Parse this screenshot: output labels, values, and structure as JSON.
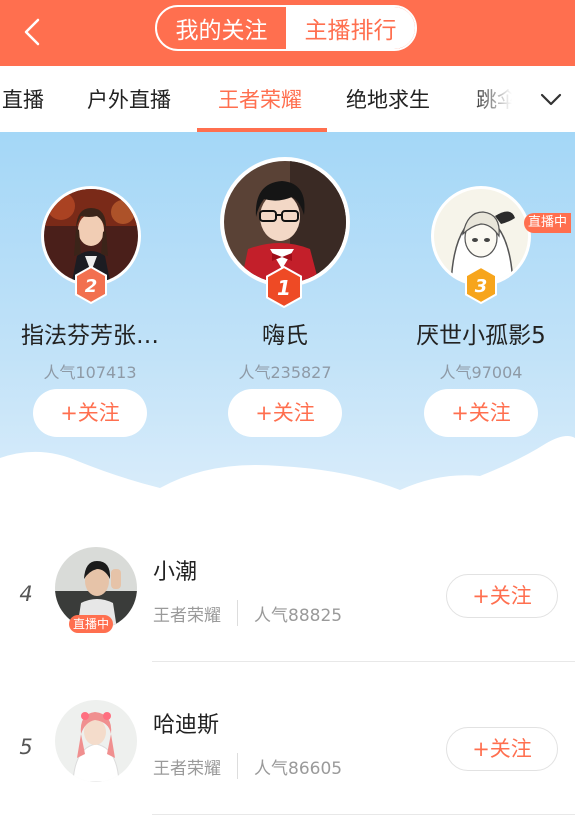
{
  "header": {
    "back_icon": "chevron-left-icon",
    "segments": [
      {
        "label": "我的关注",
        "active": false
      },
      {
        "label": "主播排行",
        "active": true
      }
    ]
  },
  "tabs": {
    "items": [
      {
        "label": "直播",
        "active": false
      },
      {
        "label": "户外直播",
        "active": false
      },
      {
        "label": "王者荣耀",
        "active": true
      },
      {
        "label": "绝地求生",
        "active": false
      },
      {
        "label": "跳伞",
        "active": false
      }
    ],
    "more_icon": "chevron-down-icon"
  },
  "podium": {
    "first": {
      "rank": "1",
      "name": "嗨氏",
      "popularity": "人气235827",
      "follow_label": "+关注",
      "live": false
    },
    "second": {
      "rank": "2",
      "name": "指法芬芳张…",
      "popularity": "人气107413",
      "follow_label": "+关注",
      "live": false
    },
    "third": {
      "rank": "3",
      "name": "厌世小孤影5",
      "popularity": "人气97004",
      "follow_label": "+关注",
      "live": true,
      "live_label": "直播中"
    }
  },
  "list": [
    {
      "rank": "4",
      "name": "小潮",
      "category": "王者荣耀",
      "popularity": "人气88825",
      "follow_label": "+关注",
      "live": true,
      "live_label": "直播中"
    },
    {
      "rank": "5",
      "name": "哈迪斯",
      "category": "王者荣耀",
      "popularity": "人气86605",
      "follow_label": "+关注",
      "live": false
    }
  ],
  "colors": {
    "accent": "#ff6f4f",
    "rank1": "#ee4a25",
    "rank2": "#f2704f",
    "rank3": "#f7a51c",
    "sky_top": "#a4d7f7",
    "sky_bottom": "#dfeffb"
  }
}
